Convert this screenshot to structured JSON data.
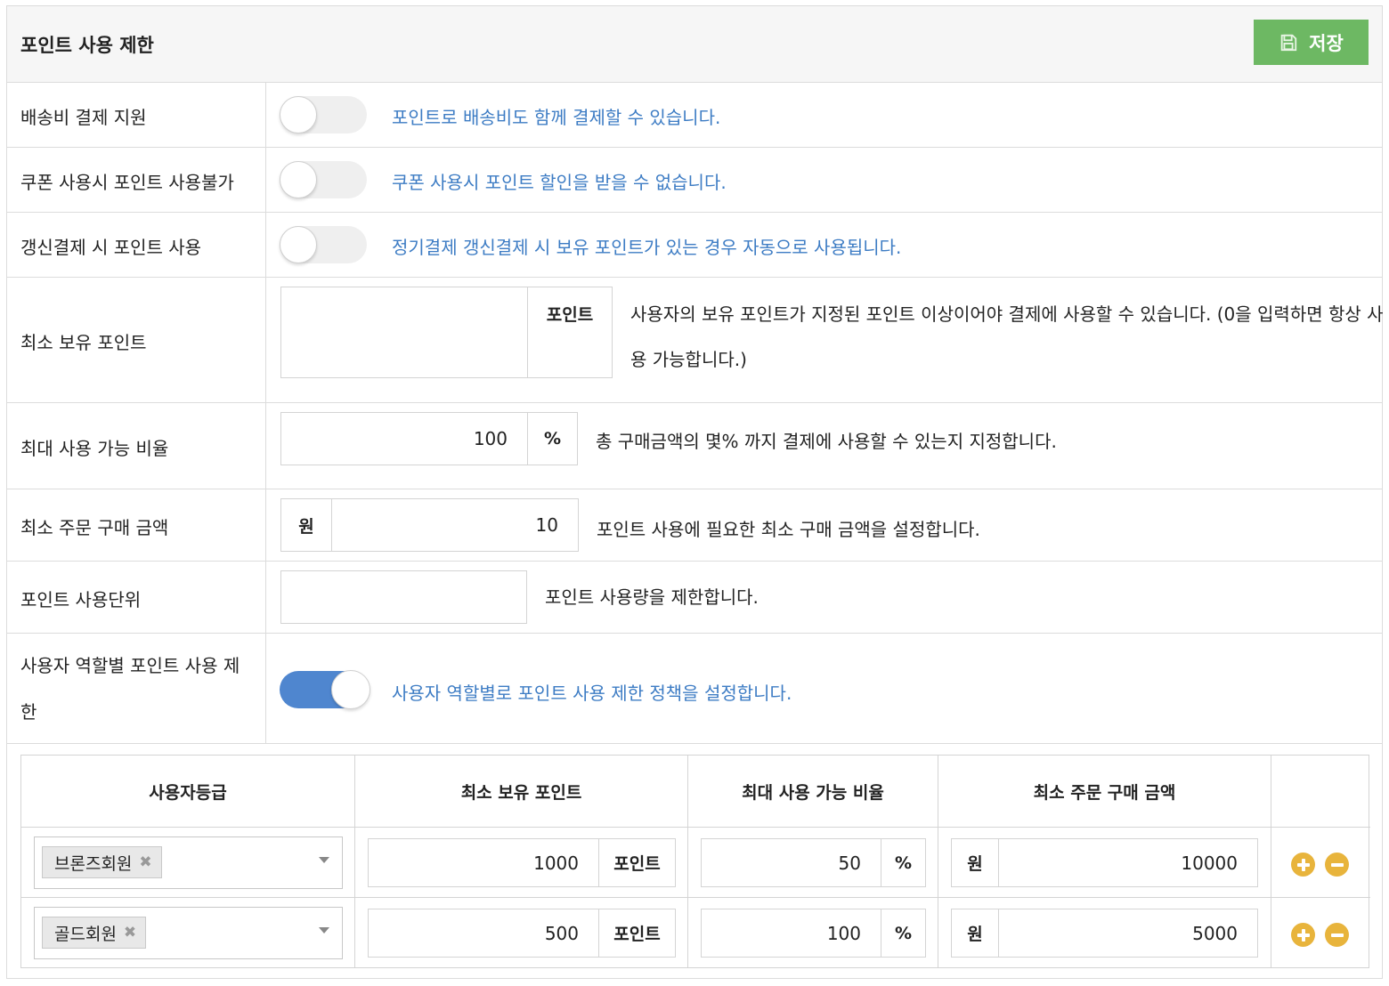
{
  "header": {
    "title": "포인트 사용 제한",
    "save_label": "저장",
    "save_icon": "floppy-disk-icon"
  },
  "settings": {
    "shipping": {
      "label": "배송비 결제 지원",
      "enabled": false,
      "help": "포인트로 배송비도 함께 결제할 수 있습니다."
    },
    "coupon": {
      "label": "쿠폰 사용시 포인트 사용불가",
      "enabled": false,
      "help": "쿠폰 사용시 포인트 할인을 받을 수 없습니다."
    },
    "renewal": {
      "label": "갱신결제 시 포인트 사용",
      "enabled": false,
      "help": "정기결제 갱신결제 시 보유 포인트가 있는 경우 자동으로 사용됩니다."
    },
    "min_points": {
      "label": "최소 보유 포인트",
      "value": "",
      "unit": "포인트",
      "help_line1": "사용자의 보유 포인트가 지정된 포인트 이상이어야 결제에 사용할 수 있습니다. (0을 입력하면 항상 사",
      "help_line2": "용 가능합니다.)"
    },
    "max_ratio": {
      "label": "최대 사용 가능 비율",
      "value": "100",
      "unit": "%",
      "help": "총 구매금액의 몇% 까지 결제에 사용할 수 있는지 지정합니다."
    },
    "min_order": {
      "label": "최소 주문 구매 금액",
      "currency": "원",
      "value": "10",
      "help": "포인트 사용에 필요한 최소 구매 금액을 설정합니다."
    },
    "unit": {
      "label": "포인트 사용단위",
      "value": "",
      "help": "포인트 사용량을 제한합니다."
    },
    "role_limit": {
      "label_line1": "사용자 역할별 포인트 사용 제",
      "label_line2": "한",
      "enabled": true,
      "help": "사용자 역할별로 포인트 사용 제한 정책을 설정합니다."
    }
  },
  "role_table": {
    "headers": [
      "사용자등급",
      "최소 보유 포인트",
      "최대 사용 가능 비율",
      "최소 주문 구매 금액"
    ],
    "rows": [
      {
        "grade": "브론즈회원",
        "min_points": "1000",
        "points_unit": "포인트",
        "ratio": "50",
        "ratio_unit": "%",
        "currency": "원",
        "min_order": "10000"
      },
      {
        "grade": "골드회원",
        "min_points": "500",
        "points_unit": "포인트",
        "ratio": "100",
        "ratio_unit": "%",
        "currency": "원",
        "min_order": "5000"
      }
    ],
    "add_icon": "plus-circle-icon",
    "remove_icon": "minus-circle-icon"
  }
}
